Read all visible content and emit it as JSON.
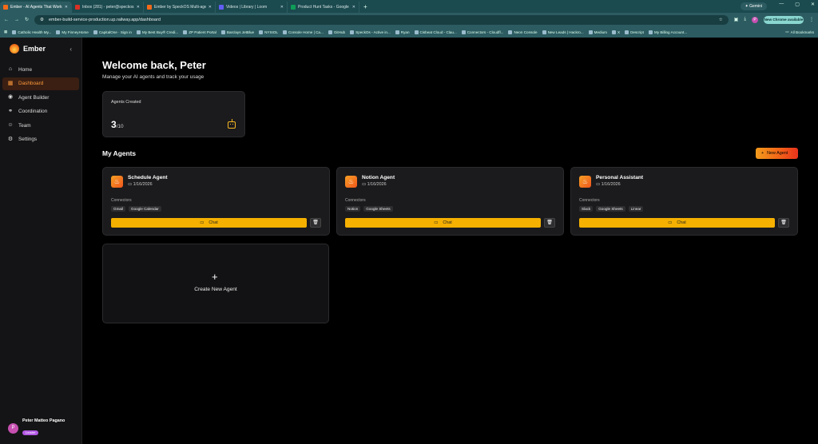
{
  "browser": {
    "tabs": [
      {
        "title": "Ember - AI Agents That Work F",
        "color": "#f36a18",
        "active": true
      },
      {
        "title": "Inbox (281) - peter@speckos.o",
        "color": "#d93025",
        "active": false
      },
      {
        "title": "Ember by SpeckOS Multi-agent",
        "color": "#f36a18",
        "active": false
      },
      {
        "title": "Videos | Library | Loom",
        "color": "#625df5",
        "active": false
      },
      {
        "title": "Product Hunt Tasks - Google S",
        "color": "#0f9d58",
        "active": false
      }
    ],
    "new_tab": "+",
    "gemini": "Gemini",
    "url": "ember-build-service-production.up.railway.app/dashboard",
    "update_button": "New Chrome available",
    "profile_initial": "P",
    "bookmarks": [
      "Catholic Health My...",
      "My FinneyHome",
      "CapitalOne · Sign in",
      "My Best Buy® Credi...",
      "ZP Patient Portal",
      "Barclays JetBlue",
      "NYSIOL",
      "Console Home | Ca...",
      "GitHub",
      "SpeckOs - Active in...",
      "Ryan",
      "Cisbeat Cloud - Clau...",
      "Connectors - Cloudfl...",
      "Neon Console",
      "New Leads | Hackro...",
      "Medium",
      "X",
      "Descript",
      "My Billing Account..."
    ],
    "all_bookmarks": "All Bookmarks"
  },
  "sidebar": {
    "brand": "Ember",
    "collapse_icon": "chevron-left-icon",
    "items": [
      {
        "label": "Home",
        "icon": "home-icon",
        "active": false
      },
      {
        "label": "Dashboard",
        "icon": "dashboard-icon",
        "active": true
      },
      {
        "label": "Agent Builder",
        "icon": "bot-icon",
        "active": false
      },
      {
        "label": "Coordination",
        "icon": "network-icon",
        "active": false
      },
      {
        "label": "Team",
        "icon": "users-icon",
        "active": false
      },
      {
        "label": "Settings",
        "icon": "gear-icon",
        "active": false
      }
    ],
    "user": {
      "initial": "P",
      "name": "Peter Matteo Pagano",
      "badge": "Leader"
    }
  },
  "main": {
    "title": "Welcome back, Peter",
    "subtitle": "Manage your AI agents and track your usage",
    "stat": {
      "label": "Agents Created",
      "value": "3",
      "max": "/10"
    },
    "section_title": "My Agents",
    "new_agent_button": "New Agent",
    "connectors_label": "Connectors",
    "chat_label": "Chat",
    "agents": [
      {
        "name": "Schedule Agent",
        "date": "1/16/2026",
        "connectors": [
          "Gmail",
          "Google Calendar"
        ]
      },
      {
        "name": "Notion Agent",
        "date": "1/16/2026",
        "connectors": [
          "Notion",
          "Google Sheets"
        ]
      },
      {
        "name": "Personal Assistant",
        "date": "1/16/2026",
        "connectors": [
          "Slack",
          "Google Sheets",
          "Linear"
        ]
      }
    ],
    "create_label": "Create New Agent"
  },
  "colors": {
    "accent": "#f5b000",
    "brand_orange": "#f36a18",
    "active_nav_bg": "#3a1f12",
    "card_bg": "#1b1b1d"
  }
}
